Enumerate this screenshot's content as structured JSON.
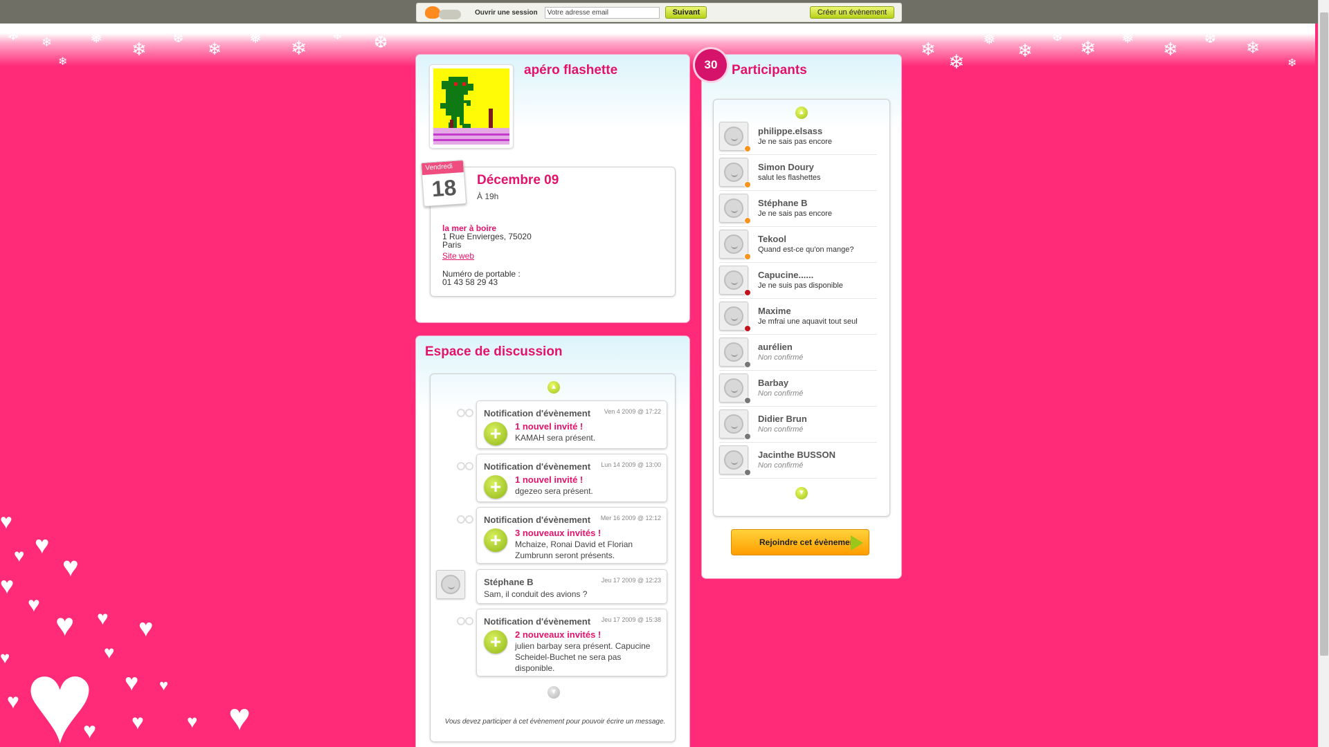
{
  "topbar": {
    "login_label": "Ouvrir une session",
    "email_placeholder": "Votre adresse email",
    "next_button": "Suivant",
    "create_button": "Créer un évènement"
  },
  "event": {
    "title": "apéro flashette",
    "day_name": "Vendredi",
    "day_number": "18",
    "month_year": "Décembre 09",
    "time": "À 19h",
    "venue_name": "la mer à boire",
    "address_line1": "1 Rue Envierges, 75020",
    "address_line2": "Paris",
    "website_link": "Site web",
    "phone_label": "Numéro de portable :",
    "phone": "01 43 58 29 43"
  },
  "discussion": {
    "title": "Espace de discussion",
    "messages": [
      {
        "author": "Notification d'évènement",
        "date": "Ven 4 2009 @ 17:22",
        "headline": "1 nouvel invité !",
        "body": "KAMAH sera présent."
      },
      {
        "author": "Notification d'évènement",
        "date": "Lun 14 2009 @ 13:00",
        "headline": "1 nouvel invité !",
        "body": "dgezeo sera présent."
      },
      {
        "author": "Notification d'évènement",
        "date": "Mer 16 2009 @ 12:12",
        "headline": "3 nouveaux invités !",
        "body": "Mchaize, Ronai David et Florian Zumbrunn seront présents."
      },
      {
        "author": "Stéphane B",
        "date": "Jeu 17 2009 @ 12:23",
        "text": "Sam, il conduit des avions ?"
      },
      {
        "author": "Notification d'évènement",
        "date": "Jeu 17 2009 @ 15:38",
        "headline": "2 nouveaux invités !",
        "body": "julien barbay sera présent. Capucine Scheidel-Buchet ne sera pas disponible."
      }
    ],
    "footer_note": "Vous devez participer à cet évènement pour pouvoir écrire un message."
  },
  "participants": {
    "count": "30",
    "title": "Participants",
    "list": [
      {
        "name": "philippe.elsass",
        "status": "Je ne sais pas encore",
        "state": "maybe"
      },
      {
        "name": "Simon Doury",
        "status": "salut les flashettes",
        "state": "maybe"
      },
      {
        "name": "Stéphane B",
        "status": "Je ne sais pas encore",
        "state": "maybe"
      },
      {
        "name": "Tekool",
        "status": "Quand est-ce qu'on mange?",
        "state": "maybe"
      },
      {
        "name": "Capucine......",
        "status": "Je ne suis pas disponible",
        "state": "no"
      },
      {
        "name": "Maxime",
        "status": "Je mfrai une aquavit tout seul",
        "state": "no"
      },
      {
        "name": "aurélien",
        "status": "Non confirmé",
        "state": "unconfirmed"
      },
      {
        "name": "Barbay",
        "status": "Non confirmé",
        "state": "unconfirmed"
      },
      {
        "name": "Didier Brun",
        "status": "Non confirmé",
        "state": "unconfirmed"
      },
      {
        "name": "Jacinthe BUSSON",
        "status": "Non confirmé",
        "state": "unconfirmed"
      }
    ],
    "join_button": "Rejoindre cet évènement"
  },
  "colors": {
    "background": "#ff2a78",
    "accent": "#e3126a",
    "status_maybe": "#f7941d",
    "status_no": "#c1121f",
    "status_unconfirmed": "#777777"
  }
}
